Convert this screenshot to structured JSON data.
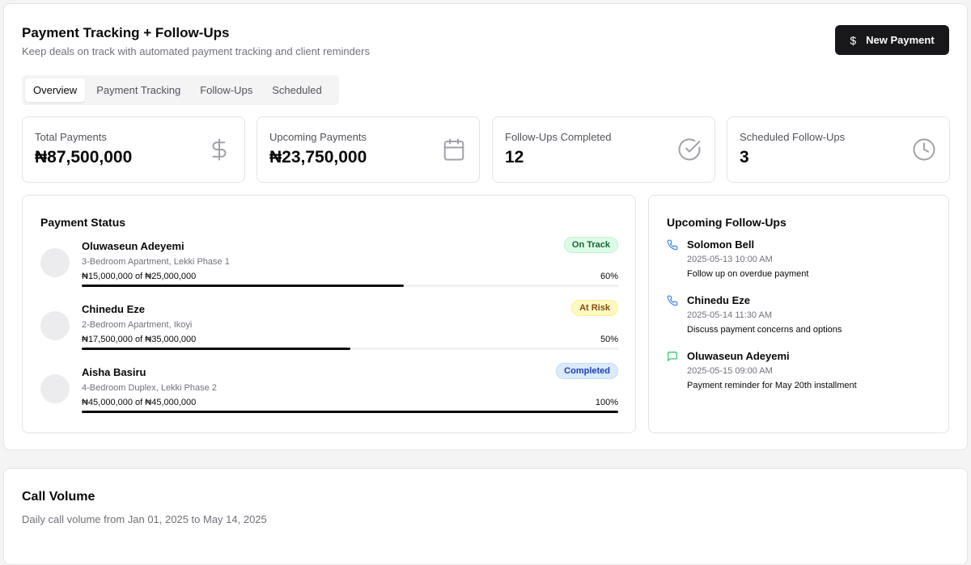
{
  "header": {
    "title": "Payment Tracking + Follow-Ups",
    "subtitle": "Keep deals on track with automated payment tracking and client reminders",
    "new_payment_label": "New Payment",
    "new_payment_icon": "dollar-icon"
  },
  "tabs": [
    {
      "label": "Overview",
      "active": true
    },
    {
      "label": "Payment Tracking",
      "active": false
    },
    {
      "label": "Follow-Ups",
      "active": false
    },
    {
      "label": "Scheduled",
      "active": false
    }
  ],
  "stats": [
    {
      "label": "Total Payments",
      "value": "₦87,500,000",
      "icon": "dollar-icon"
    },
    {
      "label": "Upcoming Payments",
      "value": "₦23,750,000",
      "icon": "calendar-icon"
    },
    {
      "label": "Follow-Ups Completed",
      "value": "12",
      "icon": "check-circle-icon"
    },
    {
      "label": "Scheduled Follow-Ups",
      "value": "3",
      "icon": "clock-icon"
    }
  ],
  "payment_status": {
    "title": "Payment Status",
    "items": [
      {
        "name": "Oluwaseun Adeyemi",
        "property": "3-Bedroom Apartment, Lekki Phase 1",
        "amount": "₦15,000,000 of ₦25,000,000",
        "percent_label": "60%",
        "progress": 0.6,
        "status": "On Track",
        "status_color": "#166534"
      },
      {
        "name": "Chinedu Eze",
        "property": "2-Bedroom Apartment, Ikoyi",
        "amount": "₦17,500,000 of ₦35,000,000",
        "percent_label": "50%",
        "progress": 0.5,
        "status": "At Risk",
        "status_color": "#854d0e"
      },
      {
        "name": "Aisha Basiru",
        "property": "4-Bedroom Duplex, Lekki Phase 2",
        "amount": "₦45,000,000 of ₦45,000,000",
        "percent_label": "100%",
        "progress": 1.0,
        "status": "Completed",
        "status_color": "#1e40af"
      }
    ]
  },
  "upcoming_followups": {
    "title": "Upcoming Follow-Ups",
    "items": [
      {
        "name": "Solomon Bell",
        "datetime": "2025-05-13 10:00 AM",
        "note": "Follow up on overdue payment",
        "icon": "phone-icon",
        "icon_color": "#3b82f6"
      },
      {
        "name": "Chinedu Eze",
        "datetime": "2025-05-14 11:30 AM",
        "note": "Discuss payment concerns and options",
        "icon": "phone-icon",
        "icon_color": "#3b82f6"
      },
      {
        "name": "Oluwaseun Adeyemi",
        "datetime": "2025-05-15 09:00 AM",
        "note": "Payment reminder for May 20th installment",
        "icon": "message-icon",
        "icon_color": "#22c55e"
      }
    ]
  },
  "call_volume": {
    "title": "Call Volume",
    "subtitle": "Daily call volume from Jan 01, 2025 to May 14, 2025"
  }
}
